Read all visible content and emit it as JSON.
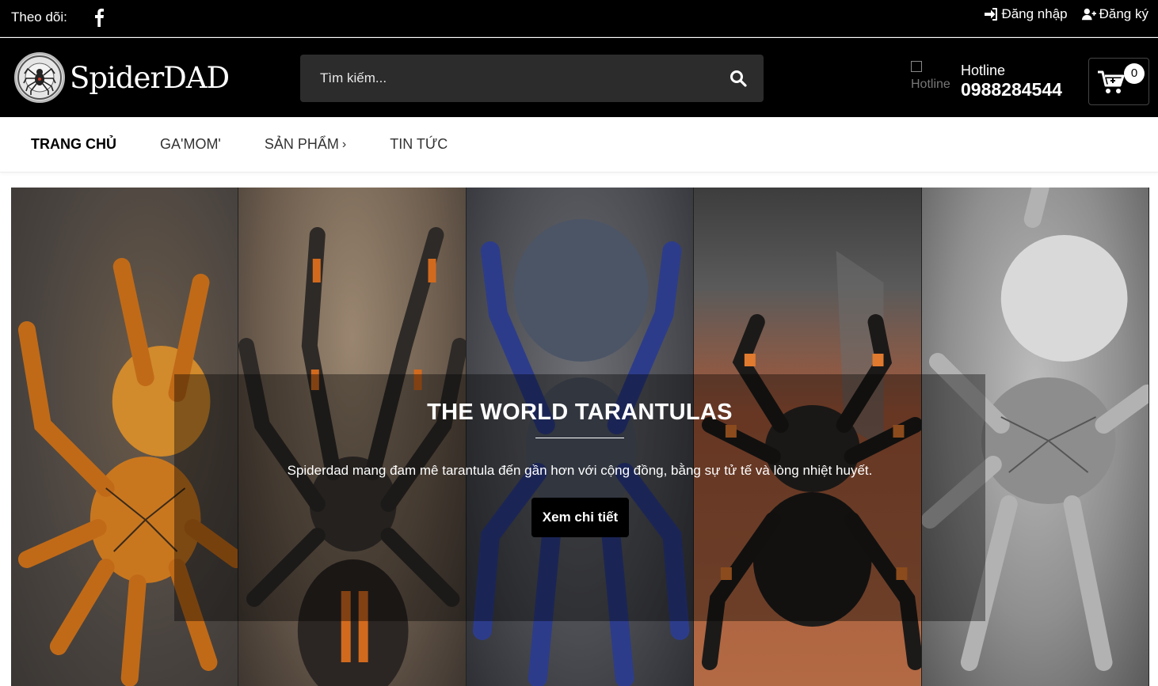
{
  "topbar": {
    "follow_label": "Theo dõi:",
    "social_icon": "facebook-icon",
    "login_label": "Đăng nhập",
    "register_label": "Đăng ký"
  },
  "header": {
    "logo_text": "SpiderDAD",
    "search_placeholder": "Tìm kiếm...",
    "hotline_img_alt": "Hotline",
    "hotline_label": "Hotline",
    "hotline_number": "0988284544",
    "cart_count": "0"
  },
  "nav": {
    "items": [
      {
        "label": "TRANG CHỦ",
        "active": true
      },
      {
        "label": "GA'MOM'"
      },
      {
        "label": "SẢN PHẨM",
        "has_submenu": true
      },
      {
        "label": "TIN TỨC"
      }
    ]
  },
  "hero": {
    "title": "THE WORLD TARANTULAS",
    "description": "Spiderdad mang đam mê tarantula đến gần hơn với cộng đồng, bằng sự tử tế và lòng nhiệt huyết.",
    "button_label": "Xem chi tiết",
    "panel_colors": [
      "#c77a2a",
      "#3a3a3a",
      "#3b4a8f",
      "#2a2a2a",
      "#9c9c9c"
    ]
  }
}
